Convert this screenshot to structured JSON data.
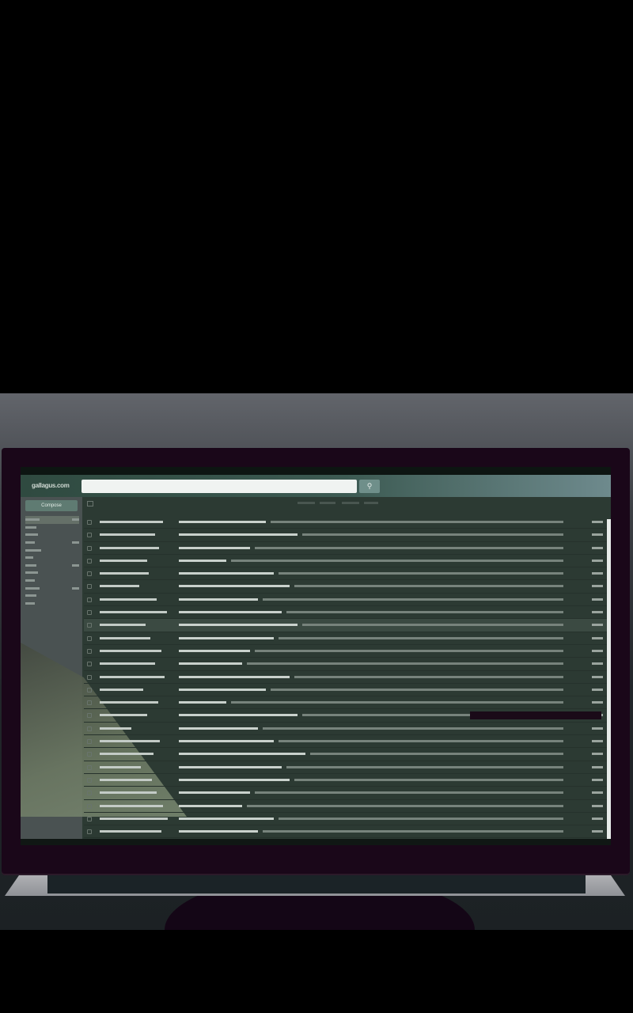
{
  "app": {
    "logo_text": "gallagus.com",
    "compose_label": "Compose",
    "search_icon": "search-icon"
  },
  "sidebar": {
    "folder_count": 12
  },
  "colors": {
    "bezel": "#1a0719",
    "screen": "#2c3a33",
    "header_accent": "#6e8a8d"
  },
  "inbox": {
    "selected_row_index": 16,
    "highlighted_row_index": 8,
    "row_count": 27
  }
}
